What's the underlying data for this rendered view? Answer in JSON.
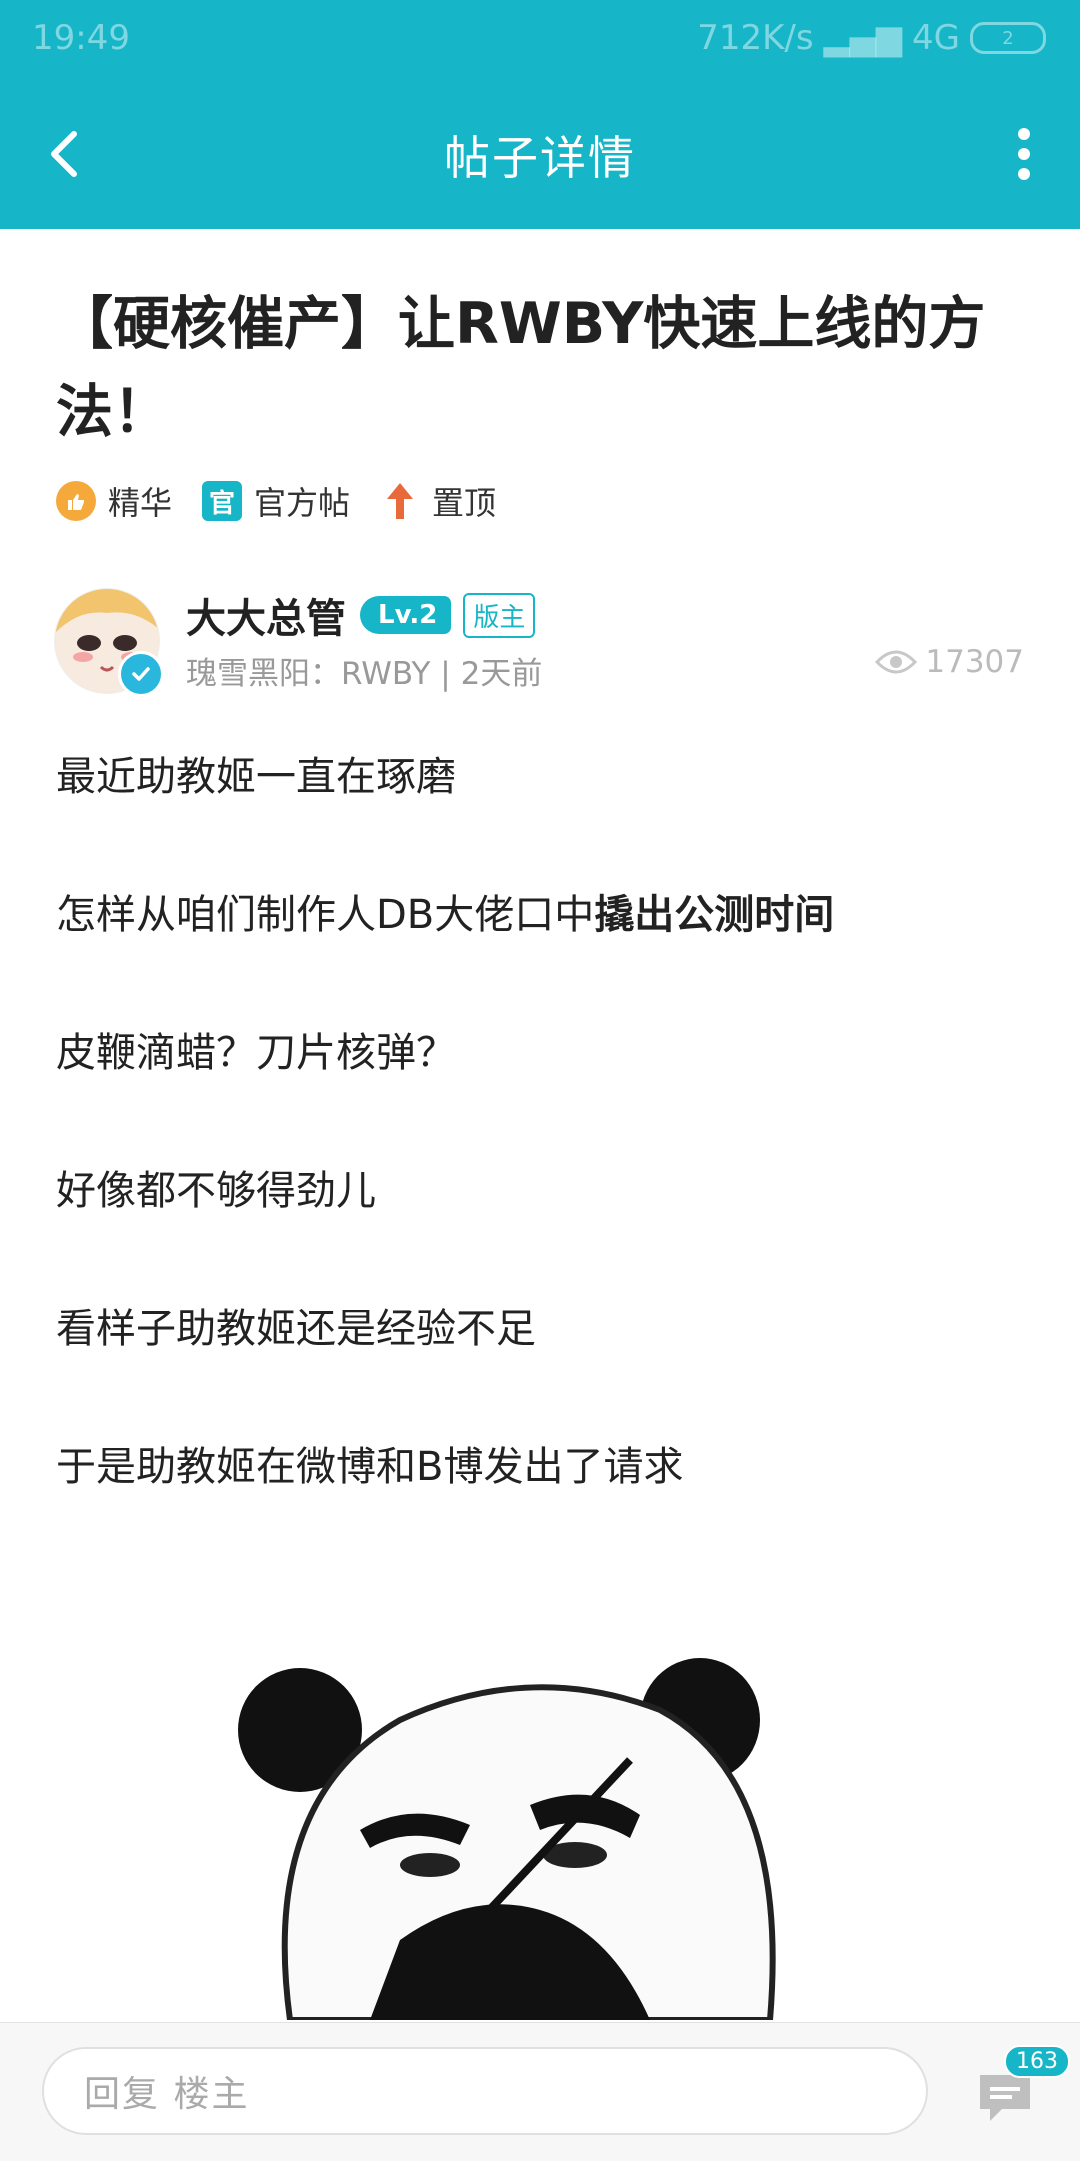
{
  "status_bar": {
    "time": "19:49",
    "network": "712K/s",
    "signal": "4G",
    "battery": "2"
  },
  "nav": {
    "title": "帖子详情"
  },
  "post": {
    "title": "【硬核催产】让RWBY快速上线的方法！",
    "tags": [
      {
        "label": "精华"
      },
      {
        "label": "官方帖",
        "icon_text": "官"
      },
      {
        "label": "置顶"
      }
    ],
    "author": {
      "name": "大大总管",
      "level": "Lv.2",
      "role": "版主",
      "meta": "瑰雪黑阳：RWBY | 2天前"
    },
    "views": "17307",
    "paragraphs": [
      {
        "text": "最近助教姬一直在琢磨"
      },
      {
        "text": "怎样从咱们制作人DB大佬口中",
        "bold": "撬出公测时间"
      },
      {
        "text": "皮鞭滴蜡？刀片核弹？"
      },
      {
        "text": "好像都不够得劲儿"
      },
      {
        "text": "看样子助教姬还是经验不足"
      },
      {
        "text": "于是助教姬在微博和B博发出了请求"
      }
    ]
  },
  "bottom_bar": {
    "reply_placeholder": "回复  楼主",
    "comment_count": "163"
  },
  "colors": {
    "accent": "#16b6c8"
  }
}
